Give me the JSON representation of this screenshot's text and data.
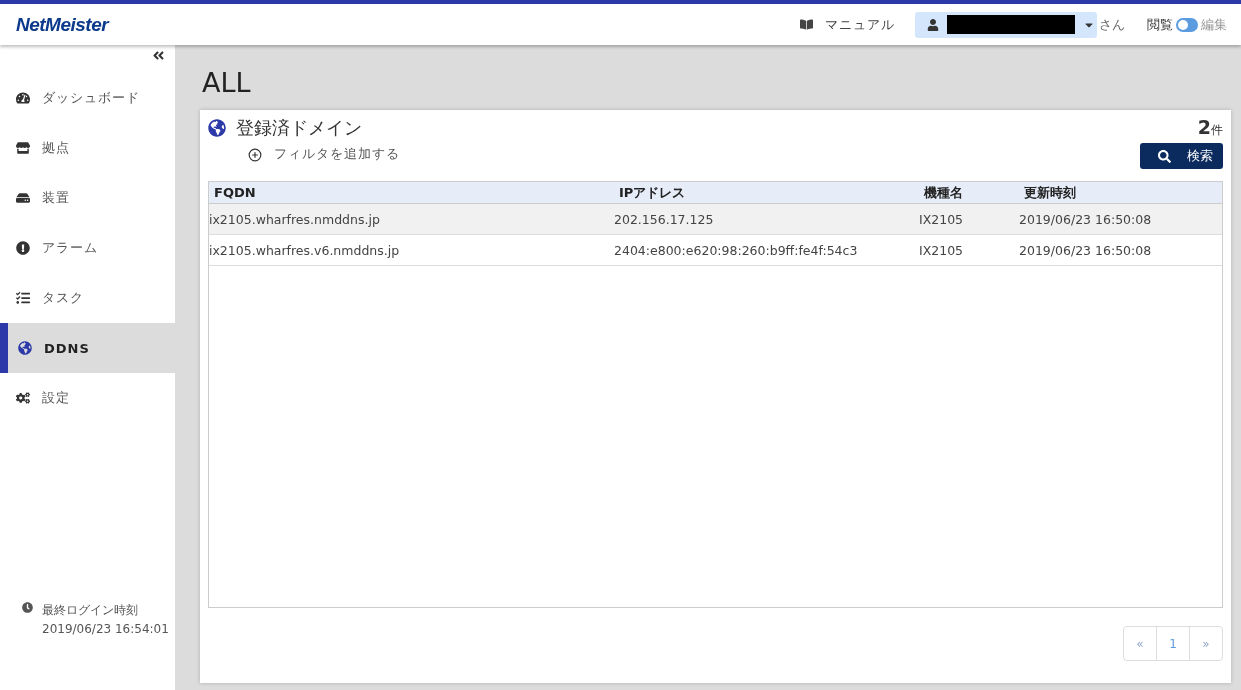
{
  "header": {
    "logo": "NetMeister",
    "manual": "マニュアル",
    "user_suffix": "さん",
    "mode": {
      "view_label": "閲覧",
      "edit_label": "編集",
      "on": false
    }
  },
  "sidebar": {
    "items": [
      {
        "label": "ダッシュボード",
        "kind": "dashboard",
        "selected": false
      },
      {
        "label": "拠点",
        "kind": "store",
        "selected": false
      },
      {
        "label": "装置",
        "kind": "device",
        "selected": false
      },
      {
        "label": "アラーム",
        "kind": "alarm",
        "selected": false
      },
      {
        "label": "タスク",
        "kind": "task",
        "selected": false
      },
      {
        "label": "DDNS",
        "kind": "globe",
        "selected": true
      },
      {
        "label": "設定",
        "kind": "gear",
        "selected": false
      }
    ],
    "last_login_label": "最終ログイン時刻",
    "last_login_time": "2019/06/23 16:54:01"
  },
  "page_title": "ALL",
  "panel": {
    "title": "登録済ドメイン",
    "add_filter": "フィルタを追加する",
    "count": "2",
    "count_unit": "件",
    "search_button": "検索",
    "table": {
      "columns": [
        "FQDN",
        "IPアドレス",
        "機種名",
        "更新時刻"
      ],
      "rows": [
        {
          "cells": [
            "ix2105.wharfres.nmddns.jp",
            "202.156.17.125",
            "IX2105",
            "2019/06/23 16:50:08"
          ],
          "selected": true
        },
        {
          "cells": [
            "ix2105.wharfres.v6.nmddns.jp",
            "2404:e800:e620:98:260:b9ff:fe4f:54c3",
            "IX2105",
            "2019/06/23 16:50:08"
          ],
          "selected": false
        }
      ]
    },
    "pagination": {
      "prev": "«",
      "pages": [
        {
          "label": "1",
          "selected": true
        }
      ],
      "next": "»"
    }
  }
}
